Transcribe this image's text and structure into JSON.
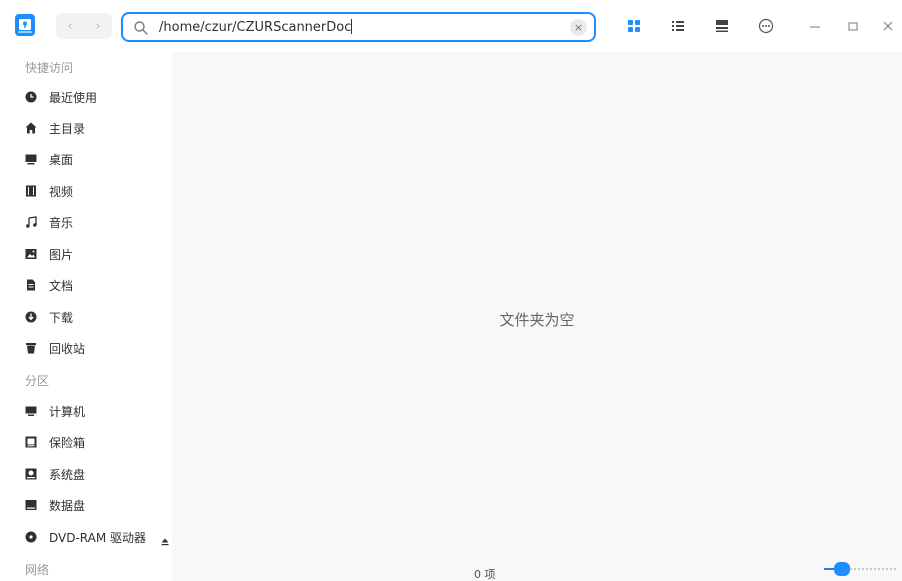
{
  "titlebar": {
    "address_path": "/home/czur/CZURScannerDoc",
    "back_glyph": "‹",
    "forward_glyph": "›",
    "clear_glyph": "×",
    "icons": [
      "search-icon",
      "icon-view-icon",
      "list-view-icon",
      "detail-view-icon",
      "more-menu-icon"
    ],
    "window_controls": [
      "minimize",
      "maximize",
      "close"
    ]
  },
  "sidebar": {
    "quick_access_title": "快捷访问",
    "quick_access": [
      {
        "label": "最近使用",
        "icon": "clock-icon"
      },
      {
        "label": "主目录",
        "icon": "home-icon"
      },
      {
        "label": "桌面",
        "icon": "desktop-icon"
      },
      {
        "label": "视频",
        "icon": "video-icon"
      },
      {
        "label": "音乐",
        "icon": "music-icon"
      },
      {
        "label": "图片",
        "icon": "picture-icon"
      },
      {
        "label": "文档",
        "icon": "document-icon"
      },
      {
        "label": "下载",
        "icon": "download-icon"
      },
      {
        "label": "回收站",
        "icon": "trash-icon"
      }
    ],
    "partitions_title": "分区",
    "partitions": [
      {
        "label": "计算机",
        "icon": "computer-icon"
      },
      {
        "label": "保险箱",
        "icon": "vault-icon"
      },
      {
        "label": "系统盘",
        "icon": "system-disk-icon"
      },
      {
        "label": "数据盘",
        "icon": "data-disk-icon"
      },
      {
        "label": "DVD-RAM 驱动器",
        "icon": "dvd-icon",
        "eject": "eject-icon"
      }
    ],
    "network_title": "网络"
  },
  "main": {
    "empty_message": "文件夹为空",
    "item_count": "0 项",
    "zoom_level": 0.2
  },
  "colors": {
    "accent": "#1f8cff",
    "sidebar_bg": "#ffffff",
    "content_bg": "#f8f8f8"
  }
}
